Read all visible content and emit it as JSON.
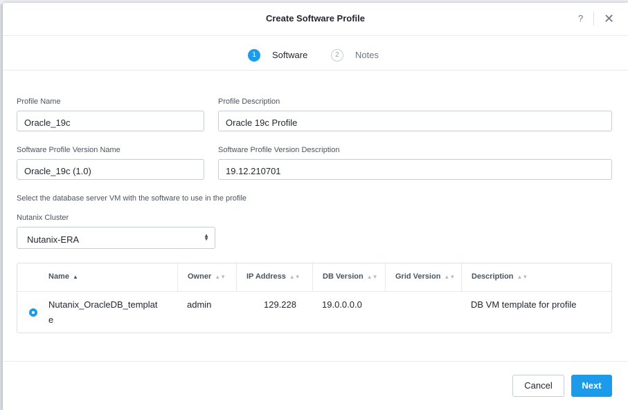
{
  "dialog": {
    "title": "Create Software Profile",
    "help_label": "?",
    "close_label": "✕"
  },
  "steps": [
    {
      "number": "1",
      "label": "Software",
      "active": true
    },
    {
      "number": "2",
      "label": "Notes",
      "active": false
    }
  ],
  "form": {
    "profile_name_label": "Profile Name",
    "profile_name_value": "Oracle_19c",
    "profile_description_label": "Profile Description",
    "profile_description_value": "Oracle 19c Profile",
    "version_name_label": "Software Profile Version Name",
    "version_name_value": "Oracle_19c (1.0)",
    "version_description_label": "Software Profile Version Description",
    "version_description_value": "19.12.210701",
    "select_hint": "Select the database server VM with the software to use in the profile",
    "cluster_label": "Nutanix Cluster",
    "cluster_value": "Nutanix-ERA"
  },
  "table": {
    "columns": [
      "Name",
      "Owner",
      "IP Address",
      "DB Version",
      "Grid Version",
      "Description"
    ],
    "rows": [
      {
        "name_line1": "Nutanix_OracleDB_templat",
        "name_line2": "e",
        "owner": "admin",
        "ip": "129.228",
        "db_version": "19.0.0.0.0",
        "grid_version": "",
        "description": "DB VM template for profile",
        "selected": true
      }
    ]
  },
  "footer": {
    "cancel_label": "Cancel",
    "next_label": "Next"
  },
  "colors": {
    "accent": "#1b9bea"
  }
}
